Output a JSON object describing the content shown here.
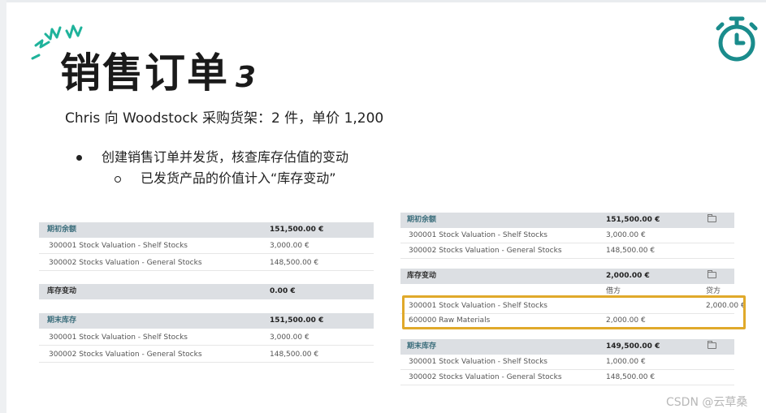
{
  "slide": {
    "title": "销售订单",
    "title_number": "3",
    "subtitle": "Chris 向 Woodstock 采购货架：2 件，单价 1,200",
    "bullet_1": "创建销售订单并发货，核查库存估值的变动",
    "bullet_2": "已发货产品的价值计入“库存变动”",
    "watermark": "CSDN @云草桑",
    "accent_color": "#1a8c8c",
    "highlight_color": "#e0a92a"
  },
  "left_table": {
    "opening_label": "期初余额",
    "opening_value": "151,500.00 €",
    "opening_row_1_label": "300001 Stock Valuation - Shelf Stocks",
    "opening_row_1_value": "3,000.00 €",
    "opening_row_2_label": "300002 Stocks Valuation - General Stocks",
    "opening_row_2_value": "148,500.00 €",
    "change_label": "库存变动",
    "change_value": "0.00 €",
    "closing_label": "期末库存",
    "closing_value": "151,500.00 €",
    "closing_row_1_label": "300001 Stock Valuation - Shelf Stocks",
    "closing_row_1_value": "3,000.00 €",
    "closing_row_2_label": "300002 Stocks Valuation - General Stocks",
    "closing_row_2_value": "148,500.00 €"
  },
  "right_table": {
    "opening_label": "期初余额",
    "opening_value": "151,500.00 €",
    "opening_row_1_label": "300001 Stock Valuation - Shelf Stocks",
    "opening_row_1_value": "3,000.00 €",
    "opening_row_2_label": "300002 Stocks Valuation - General Stocks",
    "opening_row_2_value": "148,500.00 €",
    "change_label": "库存变动",
    "change_value": "2,000.00 €",
    "debit_header": "借方",
    "credit_header": "贷方",
    "change_row_1_label": "300001 Stock Valuation - Shelf Stocks",
    "change_row_1_credit": "2,000.00 €",
    "change_row_2_label": "600000 Raw Materials",
    "change_row_2_debit": "2,000.00 €",
    "closing_label": "期末库存",
    "closing_value": "149,500.00 €",
    "closing_row_1_label": "300001 Stock Valuation - Shelf Stocks",
    "closing_row_1_value": "1,000.00 €",
    "closing_row_2_label": "300002 Stocks Valuation - General Stocks",
    "closing_row_2_value": "148,500.00 €"
  }
}
